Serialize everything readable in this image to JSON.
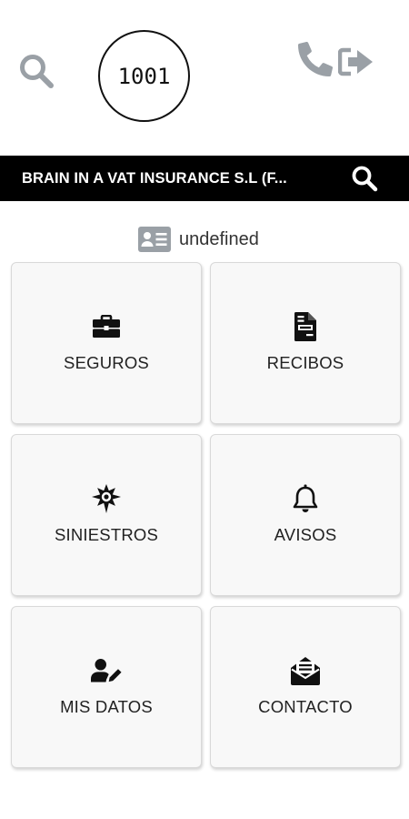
{
  "header": {
    "agent_code": "1001",
    "icons": [
      "search-icon",
      "phone-icon",
      "logout-icon"
    ]
  },
  "company": {
    "name": "BRAIN IN A VAT INSURANCE S.L (F..."
  },
  "client": {
    "id_value": "undefined",
    "icon": "id-card-icon"
  },
  "menu": {
    "tiles": [
      {
        "label": "SEGUROS",
        "icon": "briefcase-icon"
      },
      {
        "label": "RECIBOS",
        "icon": "file-invoice-icon"
      },
      {
        "label": "SINIESTROS",
        "icon": "burst-icon"
      },
      {
        "label": "AVISOS",
        "icon": "bell-icon"
      },
      {
        "label": "MIS DATOS",
        "icon": "user-edit-icon"
      },
      {
        "label": "CONTACTO",
        "icon": "envelope-open-icon"
      }
    ]
  },
  "colors": {
    "bar_background": "#000000",
    "header_icons": "#9aa0a6",
    "tile_background": "#f8f8f8"
  }
}
